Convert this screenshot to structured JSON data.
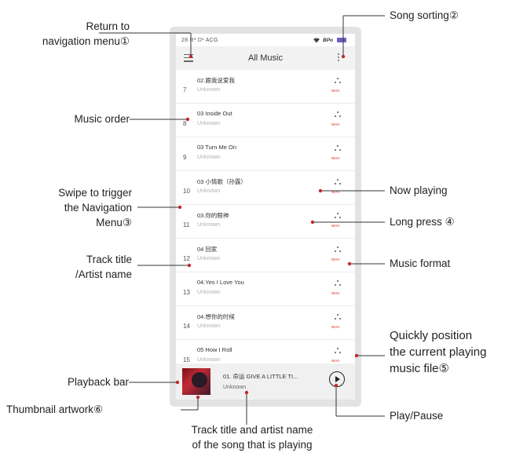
{
  "status_bar": {
    "left_text": "28 R³ D¹ ACG",
    "bt_text": "BPo"
  },
  "header": {
    "title": "All Music"
  },
  "tracks": [
    {
      "number": "7",
      "title": "02.跟我说爱我",
      "artist": "Unknown",
      "format": "WAV"
    },
    {
      "number": "8",
      "title": "03 Inside Out",
      "artist": "Unknown",
      "format": "WAV"
    },
    {
      "number": "9",
      "title": "03 Turn Me On",
      "artist": "Unknown",
      "format": "WAV"
    },
    {
      "number": "10",
      "title": "03 小情歌（孙露）",
      "artist": "Unknown",
      "format": "WAV"
    },
    {
      "number": "11",
      "title": "03.你的眼神",
      "artist": "Unknown",
      "format": "WAV"
    },
    {
      "number": "12",
      "title": "04 回家",
      "artist": "Unknown",
      "format": "WAV"
    },
    {
      "number": "13",
      "title": "04.Yes I Love You",
      "artist": "Unknown",
      "format": "WAV"
    },
    {
      "number": "14",
      "title": "04.想你的时候",
      "artist": "Unknown",
      "format": "WAV"
    },
    {
      "number": "15",
      "title": "05 How I Roll",
      "artist": "Unknown",
      "format": "WAV"
    }
  ],
  "now_playing": {
    "title": "01. 命运 GIVE A LITTLE TI...",
    "artist": "Unknown"
  },
  "annotations": {
    "return_nav_1": "Return to",
    "return_nav_2": "navigation menu①",
    "song_sorting": "Song sorting②",
    "music_order": "Music order",
    "swipe_1": "Swipe to trigger",
    "swipe_2": "the Navigation",
    "swipe_3": "Menu③",
    "track_title_1": "Track title",
    "track_title_2": "/Artist name",
    "now_playing": "Now playing",
    "long_press": "Long press ④",
    "music_format": "Music format",
    "quick_1": "Quickly position",
    "quick_2": "the current playing",
    "quick_3": "music file⑤",
    "playback_bar": "Playback bar",
    "thumbnail": "Thumbnail artwork⑥",
    "play_pause": "Play/Pause",
    "bottom_1": "Track title and artist name",
    "bottom_2": "of the song that is playing"
  },
  "colors": {
    "marker": "#c4282e",
    "format_badge": "#e0685c",
    "title_bar": "#f2f2f2"
  }
}
